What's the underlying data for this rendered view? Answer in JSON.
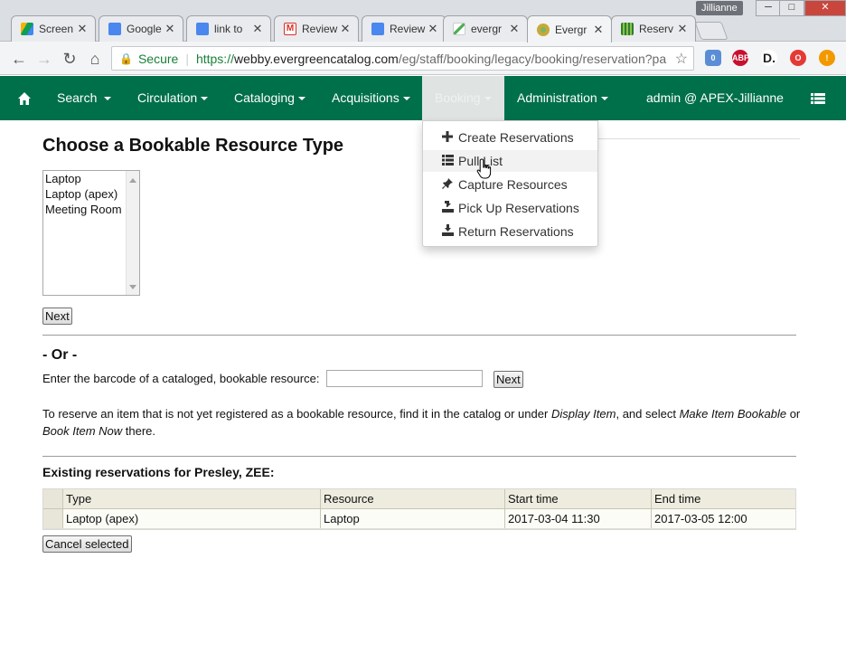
{
  "browser": {
    "user_name": "Jillianne",
    "window_controls": [
      "─",
      "□",
      "✕"
    ],
    "tabs": [
      {
        "label": "Screen",
        "icon": "google-drive-icon",
        "color": "#2f9e44"
      },
      {
        "label": "Google",
        "icon": "google-docs-icon",
        "color": "#4a87ee"
      },
      {
        "label": "link to",
        "icon": "google-docs-icon",
        "color": "#4a87ee"
      },
      {
        "label": "Review",
        "icon": "gmail-icon",
        "color": "#d93025"
      },
      {
        "label": "Review",
        "icon": "google-docs-icon",
        "color": "#4a87ee"
      },
      {
        "label": "evergr",
        "icon": "pencil-icon",
        "color": "#4caf50"
      },
      {
        "label": "Evergr",
        "icon": "evergreen-icon",
        "color": "#c8a93a"
      },
      {
        "label": "Reserv",
        "icon": "book-icon",
        "color": "#2e7d32"
      }
    ],
    "tab_close": "✕",
    "omnibox": {
      "secure_label": "Secure",
      "url_scheme": "https://",
      "url_host": "webby.evergreencatalog.com",
      "url_path": "/eg/staff/booking/legacy/booking/reservation?pa"
    },
    "extensions": [
      {
        "name": "lastpass-icon",
        "label": "0",
        "color": "#5b8dd6"
      },
      {
        "name": "adblock-icon",
        "label": "ABP",
        "color": "#c8102e"
      },
      {
        "name": "dashlane-icon",
        "label": "D.",
        "color": "#222222"
      },
      {
        "name": "opera-icon",
        "label": "O",
        "color": "#e53935"
      },
      {
        "name": "alert-icon",
        "label": "!",
        "color": "#f29900"
      }
    ]
  },
  "navbar": {
    "accent": "#00704a",
    "items": [
      {
        "label": "Search"
      },
      {
        "label": "Circulation"
      },
      {
        "label": "Cataloging"
      },
      {
        "label": "Acquisitions"
      },
      {
        "label": "Booking"
      },
      {
        "label": "Administration"
      }
    ],
    "user": "admin @ APEX-Jillianne"
  },
  "booking_menu": {
    "items": [
      {
        "label": "Create Reservations",
        "icon": "plus-icon"
      },
      {
        "label": "Pull List",
        "icon": "list-icon"
      },
      {
        "label": "Capture Resources",
        "icon": "pushpin-icon"
      },
      {
        "label": "Pick Up Reservations",
        "icon": "pickup-icon"
      },
      {
        "label": "Return Reservations",
        "icon": "return-icon"
      }
    ]
  },
  "page": {
    "title": "Choose a Bookable Resource Type",
    "resource_types": [
      "Laptop",
      "Laptop (apex)",
      "Meeting Room"
    ],
    "next_label": "Next",
    "or_heading": "- Or -",
    "barcode_label": "Enter the barcode of a cataloged, bookable resource:",
    "barcode_value": "",
    "barcode_next_label": "Next",
    "note": {
      "p1": "To reserve an item that is not yet registered as a bookable resource, find it in the catalog or under ",
      "em1": "Display Item",
      "p2": ", and select ",
      "em2": "Make Item Bookable",
      "p3": " or ",
      "em3": "Book Item Now",
      "p4": " there."
    },
    "existing_heading": "Existing reservations for Presley, ZEE:",
    "reservations": {
      "columns": [
        "Type",
        "Resource",
        "Start time",
        "End time"
      ],
      "rows": [
        [
          "Laptop (apex)",
          "Laptop",
          "2017-03-04 11:30",
          "2017-03-05 12:00"
        ]
      ]
    },
    "cancel_label": "Cancel selected"
  }
}
